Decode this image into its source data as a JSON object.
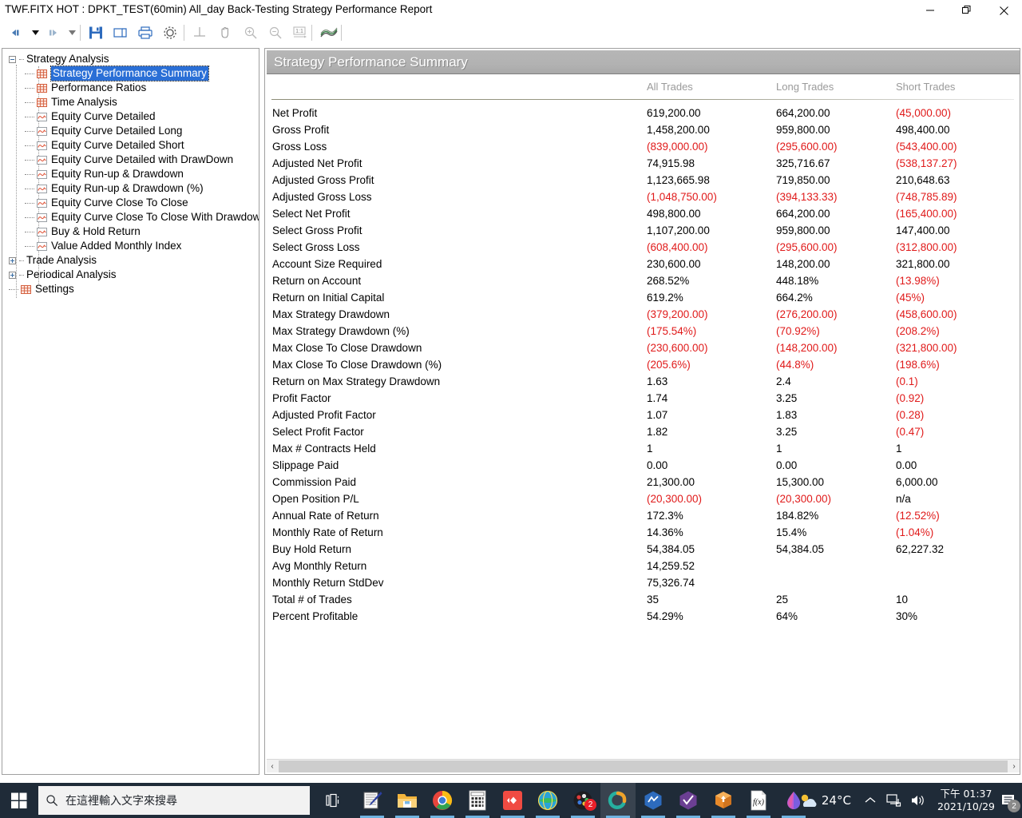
{
  "window": {
    "title": "TWF.FITX HOT : DPKT_TEST(60min) All_day Back-Testing Strategy Performance Report",
    "minimize_label": "Minimize",
    "maximize_label": "Restore",
    "close_label": "Close"
  },
  "toolbar": {
    "items": [
      {
        "name": "back-button",
        "glyph": "◀▌"
      },
      {
        "name": "back-dropdown",
        "glyph": "▼"
      },
      {
        "name": "forward-button",
        "glyph": "▐▶"
      },
      {
        "name": "forward-dropdown",
        "glyph": "▼"
      },
      {
        "name": "save-button",
        "glyph": "save-icon"
      },
      {
        "name": "copy-button",
        "glyph": "copy-icon"
      },
      {
        "name": "print-button",
        "glyph": "print-icon"
      },
      {
        "name": "settings-button",
        "glyph": "gear-icon"
      },
      {
        "name": "crosshair-button",
        "glyph": "crosshair-icon"
      },
      {
        "name": "pan-button",
        "glyph": "hand-icon"
      },
      {
        "name": "zoom-in-button",
        "glyph": "zoom-in-icon"
      },
      {
        "name": "zoom-out-button",
        "glyph": "zoom-out-icon"
      },
      {
        "name": "zoom-reset-button",
        "glyph": "1:1"
      },
      {
        "name": "chart-button",
        "glyph": "chart-icon"
      }
    ]
  },
  "tree": {
    "nodes": [
      {
        "label": "Strategy Analysis",
        "level": 0,
        "icon": "none",
        "expander": "minus",
        "selected": false
      },
      {
        "label": "Strategy Performance Summary",
        "level": 1,
        "icon": "grid",
        "expander": "none",
        "selected": true
      },
      {
        "label": "Performance Ratios",
        "level": 1,
        "icon": "grid",
        "expander": "none",
        "selected": false
      },
      {
        "label": "Time Analysis",
        "level": 1,
        "icon": "grid",
        "expander": "none",
        "selected": false
      },
      {
        "label": "Equity Curve Detailed",
        "level": 1,
        "icon": "chart",
        "expander": "none",
        "selected": false
      },
      {
        "label": "Equity Curve Detailed Long",
        "level": 1,
        "icon": "chart",
        "expander": "none",
        "selected": false
      },
      {
        "label": "Equity Curve Detailed Short",
        "level": 1,
        "icon": "chart",
        "expander": "none",
        "selected": false
      },
      {
        "label": "Equity Curve Detailed with DrawDown",
        "level": 1,
        "icon": "chart",
        "expander": "none",
        "selected": false
      },
      {
        "label": "Equity Run-up & Drawdown",
        "level": 1,
        "icon": "chart",
        "expander": "none",
        "selected": false
      },
      {
        "label": "Equity Run-up & Drawdown (%)",
        "level": 1,
        "icon": "chart",
        "expander": "none",
        "selected": false
      },
      {
        "label": "Equity Curve Close To Close",
        "level": 1,
        "icon": "chart",
        "expander": "none",
        "selected": false
      },
      {
        "label": "Equity Curve Close To Close With Drawdown",
        "level": 1,
        "icon": "chart",
        "expander": "none",
        "selected": false
      },
      {
        "label": "Buy & Hold Return",
        "level": 1,
        "icon": "chart",
        "expander": "none",
        "selected": false
      },
      {
        "label": "Value Added Monthly Index",
        "level": 1,
        "icon": "chart",
        "expander": "none",
        "selected": false
      },
      {
        "label": "Trade Analysis",
        "level": 0,
        "icon": "none",
        "expander": "plus",
        "selected": false
      },
      {
        "label": "Periodical Analysis",
        "level": 0,
        "icon": "none",
        "expander": "plus",
        "selected": false
      },
      {
        "label": "Settings",
        "level": 0,
        "icon": "grid",
        "expander": "none",
        "selected": false
      }
    ]
  },
  "report": {
    "title": "Strategy Performance Summary",
    "columns": [
      "All Trades",
      "Long Trades",
      "Short Trades"
    ],
    "rows": [
      {
        "label": "Net Profit",
        "all": "619,200.00",
        "long": "664,200.00",
        "short": "(45,000.00)",
        "all_neg": false,
        "long_neg": false,
        "short_neg": true
      },
      {
        "label": "Gross Profit",
        "all": "1,458,200.00",
        "long": "959,800.00",
        "short": "498,400.00",
        "all_neg": false,
        "long_neg": false,
        "short_neg": false
      },
      {
        "label": "Gross Loss",
        "all": "(839,000.00)",
        "long": "(295,600.00)",
        "short": "(543,400.00)",
        "all_neg": true,
        "long_neg": true,
        "short_neg": true
      },
      {
        "label": "Adjusted Net Profit",
        "all": "74,915.98",
        "long": "325,716.67",
        "short": "(538,137.27)",
        "all_neg": false,
        "long_neg": false,
        "short_neg": true
      },
      {
        "label": "Adjusted Gross Profit",
        "all": "1,123,665.98",
        "long": "719,850.00",
        "short": "210,648.63",
        "all_neg": false,
        "long_neg": false,
        "short_neg": false
      },
      {
        "label": "Adjusted Gross Loss",
        "all": "(1,048,750.00)",
        "long": "(394,133.33)",
        "short": "(748,785.89)",
        "all_neg": true,
        "long_neg": true,
        "short_neg": true
      },
      {
        "label": "Select Net Profit",
        "all": "498,800.00",
        "long": "664,200.00",
        "short": "(165,400.00)",
        "all_neg": false,
        "long_neg": false,
        "short_neg": true
      },
      {
        "label": "Select Gross Profit",
        "all": "1,107,200.00",
        "long": "959,800.00",
        "short": "147,400.00",
        "all_neg": false,
        "long_neg": false,
        "short_neg": false
      },
      {
        "label": "Select Gross Loss",
        "all": "(608,400.00)",
        "long": "(295,600.00)",
        "short": "(312,800.00)",
        "all_neg": true,
        "long_neg": true,
        "short_neg": true
      },
      {
        "label": "Account Size Required",
        "all": "230,600.00",
        "long": "148,200.00",
        "short": "321,800.00",
        "all_neg": false,
        "long_neg": false,
        "short_neg": false
      },
      {
        "label": "Return on Account",
        "all": "268.52%",
        "long": "448.18%",
        "short": "(13.98%)",
        "all_neg": false,
        "long_neg": false,
        "short_neg": true
      },
      {
        "label": "Return on Initial Capital",
        "all": "619.2%",
        "long": "664.2%",
        "short": "(45%)",
        "all_neg": false,
        "long_neg": false,
        "short_neg": true
      },
      {
        "label": "Max Strategy Drawdown",
        "all": "(379,200.00)",
        "long": "(276,200.00)",
        "short": "(458,600.00)",
        "all_neg": true,
        "long_neg": true,
        "short_neg": true
      },
      {
        "label": "Max Strategy Drawdown (%)",
        "all": "(175.54%)",
        "long": "(70.92%)",
        "short": "(208.2%)",
        "all_neg": true,
        "long_neg": true,
        "short_neg": true
      },
      {
        "label": "Max Close To Close Drawdown",
        "all": "(230,600.00)",
        "long": "(148,200.00)",
        "short": "(321,800.00)",
        "all_neg": true,
        "long_neg": true,
        "short_neg": true
      },
      {
        "label": "Max Close To Close Drawdown (%)",
        "all": "(205.6%)",
        "long": "(44.8%)",
        "short": "(198.6%)",
        "all_neg": true,
        "long_neg": true,
        "short_neg": true
      },
      {
        "label": "Return on Max Strategy Drawdown",
        "all": "1.63",
        "long": "2.4",
        "short": "(0.1)",
        "all_neg": false,
        "long_neg": false,
        "short_neg": true
      },
      {
        "label": "Profit Factor",
        "all": "1.74",
        "long": "3.25",
        "short": "(0.92)",
        "all_neg": false,
        "long_neg": false,
        "short_neg": true
      },
      {
        "label": "Adjusted Profit Factor",
        "all": "1.07",
        "long": "1.83",
        "short": "(0.28)",
        "all_neg": false,
        "long_neg": false,
        "short_neg": true
      },
      {
        "label": "Select Profit Factor",
        "all": "1.82",
        "long": "3.25",
        "short": "(0.47)",
        "all_neg": false,
        "long_neg": false,
        "short_neg": true
      },
      {
        "label": "Max # Contracts Held",
        "all": "1",
        "long": "1",
        "short": "1",
        "all_neg": false,
        "long_neg": false,
        "short_neg": false
      },
      {
        "label": "Slippage Paid",
        "all": "0.00",
        "long": "0.00",
        "short": "0.00",
        "all_neg": false,
        "long_neg": false,
        "short_neg": false
      },
      {
        "label": "Commission Paid",
        "all": "21,300.00",
        "long": "15,300.00",
        "short": "6,000.00",
        "all_neg": false,
        "long_neg": false,
        "short_neg": false
      },
      {
        "label": "Open Position P/L",
        "all": "(20,300.00)",
        "long": "(20,300.00)",
        "short": "n/a",
        "all_neg": true,
        "long_neg": true,
        "short_neg": false
      },
      {
        "label": "Annual Rate of Return",
        "all": "172.3%",
        "long": "184.82%",
        "short": "(12.52%)",
        "all_neg": false,
        "long_neg": false,
        "short_neg": true
      },
      {
        "label": "Monthly Rate of Return",
        "all": "14.36%",
        "long": "15.4%",
        "short": "(1.04%)",
        "all_neg": false,
        "long_neg": false,
        "short_neg": true
      },
      {
        "label": "Buy  Hold Return",
        "all": "54,384.05",
        "long": "54,384.05",
        "short": "62,227.32",
        "all_neg": false,
        "long_neg": false,
        "short_neg": false
      },
      {
        "label": "Avg Monthly Return",
        "all": "14,259.52",
        "long": "",
        "short": "",
        "all_neg": false,
        "long_neg": false,
        "short_neg": false
      },
      {
        "label": "Monthly Return StdDev",
        "all": "75,326.74",
        "long": "",
        "short": "",
        "all_neg": false,
        "long_neg": false,
        "short_neg": false
      },
      {
        "label": "Total # of Trades",
        "all": "35",
        "long": "25",
        "short": "10",
        "all_neg": false,
        "long_neg": false,
        "short_neg": false
      },
      {
        "label": "Percent Profitable",
        "all": "54.29%",
        "long": "64%",
        "short": "30%",
        "all_neg": false,
        "long_neg": false,
        "short_neg": false
      }
    ]
  },
  "scrollbar": {
    "left_arrow": "‹",
    "right_arrow": "›"
  },
  "taskbar": {
    "search_placeholder": "在這裡輸入文字來搜尋",
    "weather_temp": "24°C",
    "clock_time": "下午 01:37",
    "clock_date": "2021/10/29",
    "notification_count": "2",
    "chrome_badge": "2",
    "apps": [
      {
        "name": "task-view-icon"
      },
      {
        "name": "notepad-icon"
      },
      {
        "name": "file-explorer-icon"
      },
      {
        "name": "chrome-icon"
      },
      {
        "name": "calculator-icon"
      },
      {
        "name": "red-diamond-app-icon"
      },
      {
        "name": "globe-app-icon"
      },
      {
        "name": "dark-chart-app-icon"
      },
      {
        "name": "multicharts-icon"
      },
      {
        "name": "blue-hex-app-icon"
      },
      {
        "name": "purple-hex-app-icon"
      },
      {
        "name": "orange-box-app-icon"
      },
      {
        "name": "formula-doc-icon"
      },
      {
        "name": "paint-3d-icon"
      }
    ]
  },
  "colors": {
    "negative": "#e01a1a",
    "selection": "#2a6fd6",
    "header_bar": "#b2b2b2",
    "taskbar": "#1f2b38"
  }
}
